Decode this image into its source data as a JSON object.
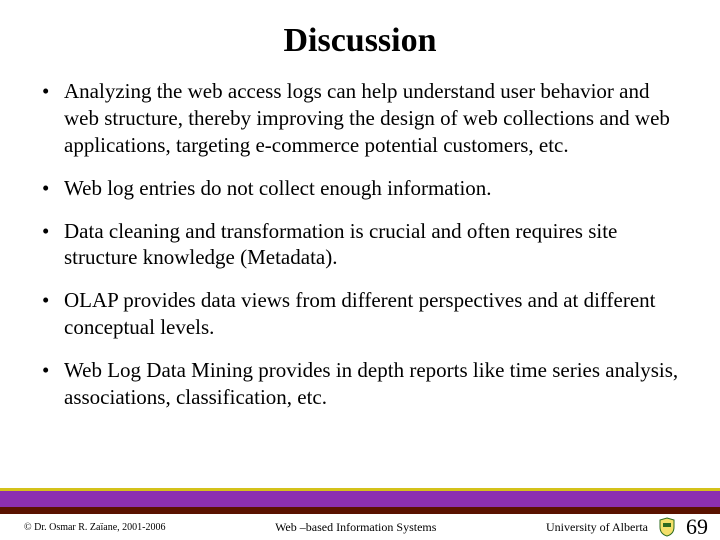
{
  "title": "Discussion",
  "bullets": [
    "Analyzing the web access logs can help understand user behavior and web structure, thereby improving the design of web collections and web applications, targeting e-commerce potential customers, etc.",
    "Web log entries do not collect enough information.",
    "Data cleaning and transformation is crucial and often requires site structure knowledge (Metadata).",
    "OLAP provides data views from different perspectives and at different conceptual levels.",
    "Web Log Data Mining provides in depth reports like time series analysis, associations, classification, etc."
  ],
  "footer": {
    "copyright": "© Dr. Osmar R. Zaïane, 2001-2006",
    "center": "Web –based Information Systems",
    "university": "University of Alberta",
    "page": "69"
  },
  "colors": {
    "accent_yellow": "#d4c21a",
    "accent_purple": "#8c2fb0",
    "accent_darkred": "#5a1200"
  }
}
